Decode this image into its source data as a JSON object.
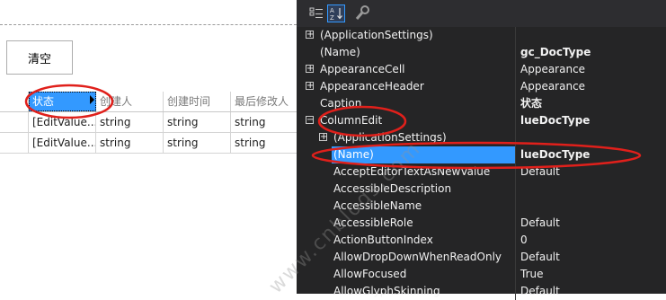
{
  "designer": {
    "clear_button": "清空",
    "grid": {
      "headers": [
        "",
        "状态",
        "创建人",
        "创建时间",
        "最后修改人"
      ],
      "rows": [
        [
          "",
          "[EditValue...",
          "string",
          "string",
          "string"
        ],
        [
          "",
          "[EditValue...",
          "string",
          "string",
          "string"
        ]
      ]
    }
  },
  "property_grid": {
    "toolbar": {
      "categorized": "categorized-icon",
      "alphabetical": "alphabetical-sort-icon",
      "property_pages": "wrench-icon"
    },
    "rows": [
      {
        "name": "(ApplicationSettings)",
        "value": "",
        "expander": "+",
        "indent": false,
        "bold": false
      },
      {
        "name": "(Name)",
        "value": "gc_DocType",
        "expander": "",
        "indent": false,
        "bold": true
      },
      {
        "name": "AppearanceCell",
        "value": "Appearance",
        "expander": "+",
        "indent": false,
        "bold": false
      },
      {
        "name": "AppearanceHeader",
        "value": "Appearance",
        "expander": "+",
        "indent": false,
        "bold": false
      },
      {
        "name": "Caption",
        "value": "状态",
        "expander": "",
        "indent": false,
        "bold": true
      },
      {
        "name": "ColumnEdit",
        "value": "lueDocType",
        "expander": "−",
        "indent": false,
        "bold": true
      },
      {
        "name": "(ApplicationSettings)",
        "value": "",
        "expander": "+",
        "indent": true,
        "bold": false
      },
      {
        "name": "(Name)",
        "value": "lueDocType",
        "expander": "",
        "indent": true,
        "bold": true,
        "selected": true
      },
      {
        "name": "AcceptEditorTextAsNewValue",
        "value": "Default",
        "expander": "",
        "indent": true,
        "bold": false
      },
      {
        "name": "AccessibleDescription",
        "value": "",
        "expander": "",
        "indent": true,
        "bold": false
      },
      {
        "name": "AccessibleName",
        "value": "",
        "expander": "",
        "indent": true,
        "bold": false
      },
      {
        "name": "AccessibleRole",
        "value": "Default",
        "expander": "",
        "indent": true,
        "bold": false
      },
      {
        "name": "ActionButtonIndex",
        "value": "0",
        "expander": "",
        "indent": true,
        "bold": false
      },
      {
        "name": "AllowDropDownWhenReadOnly",
        "value": "Default",
        "expander": "",
        "indent": true,
        "bold": false
      },
      {
        "name": "AllowFocused",
        "value": "True",
        "expander": "",
        "indent": true,
        "bold": false
      },
      {
        "name": "AllowGlyphSkinning",
        "value": "Default",
        "expander": "",
        "indent": true,
        "bold": false
      }
    ]
  },
  "colors": {
    "selection": "#3399ff",
    "annotation": "#e0201b",
    "panel_bg": "#252526"
  }
}
